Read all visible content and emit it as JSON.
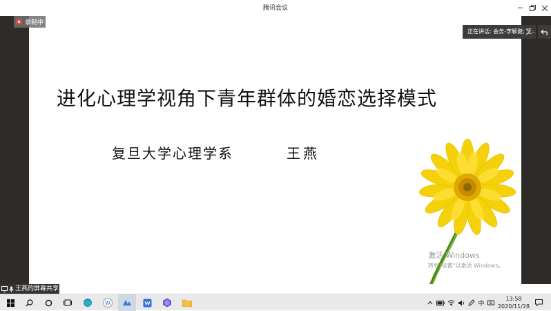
{
  "window": {
    "title": "腾讯会议"
  },
  "recording": {
    "label": "录制中"
  },
  "speaking": {
    "label": "正在讲话: 会务-李颖健; 王…"
  },
  "slide": {
    "title": "进化心理学视角下青年群体的婚恋选择模式",
    "subtitle": "复旦大学心理学系",
    "author": "王燕"
  },
  "watermark": {
    "line1": "激活 Windows",
    "line2": "转到\"设置\"以激活 Windows。"
  },
  "share": {
    "label": "王燕的屏幕共享"
  },
  "taskbar": {
    "apps": [
      "start-icon",
      "search-icon",
      "cortana-icon",
      "task-view-icon",
      "edge-icon",
      "wps-icon",
      "tencent-meeting-icon",
      "wps-office-icon",
      "app-icon",
      "file-explorer-icon"
    ],
    "ime": "中",
    "time": "13:58",
    "date": "2020/11/28"
  },
  "colors": {
    "viewer_bg": "#2f2b28",
    "flower_petal": "#f5d10a",
    "flower_center": "#e0a800",
    "stem": "#4a8a1c",
    "record_dot": "#e04b4b"
  }
}
